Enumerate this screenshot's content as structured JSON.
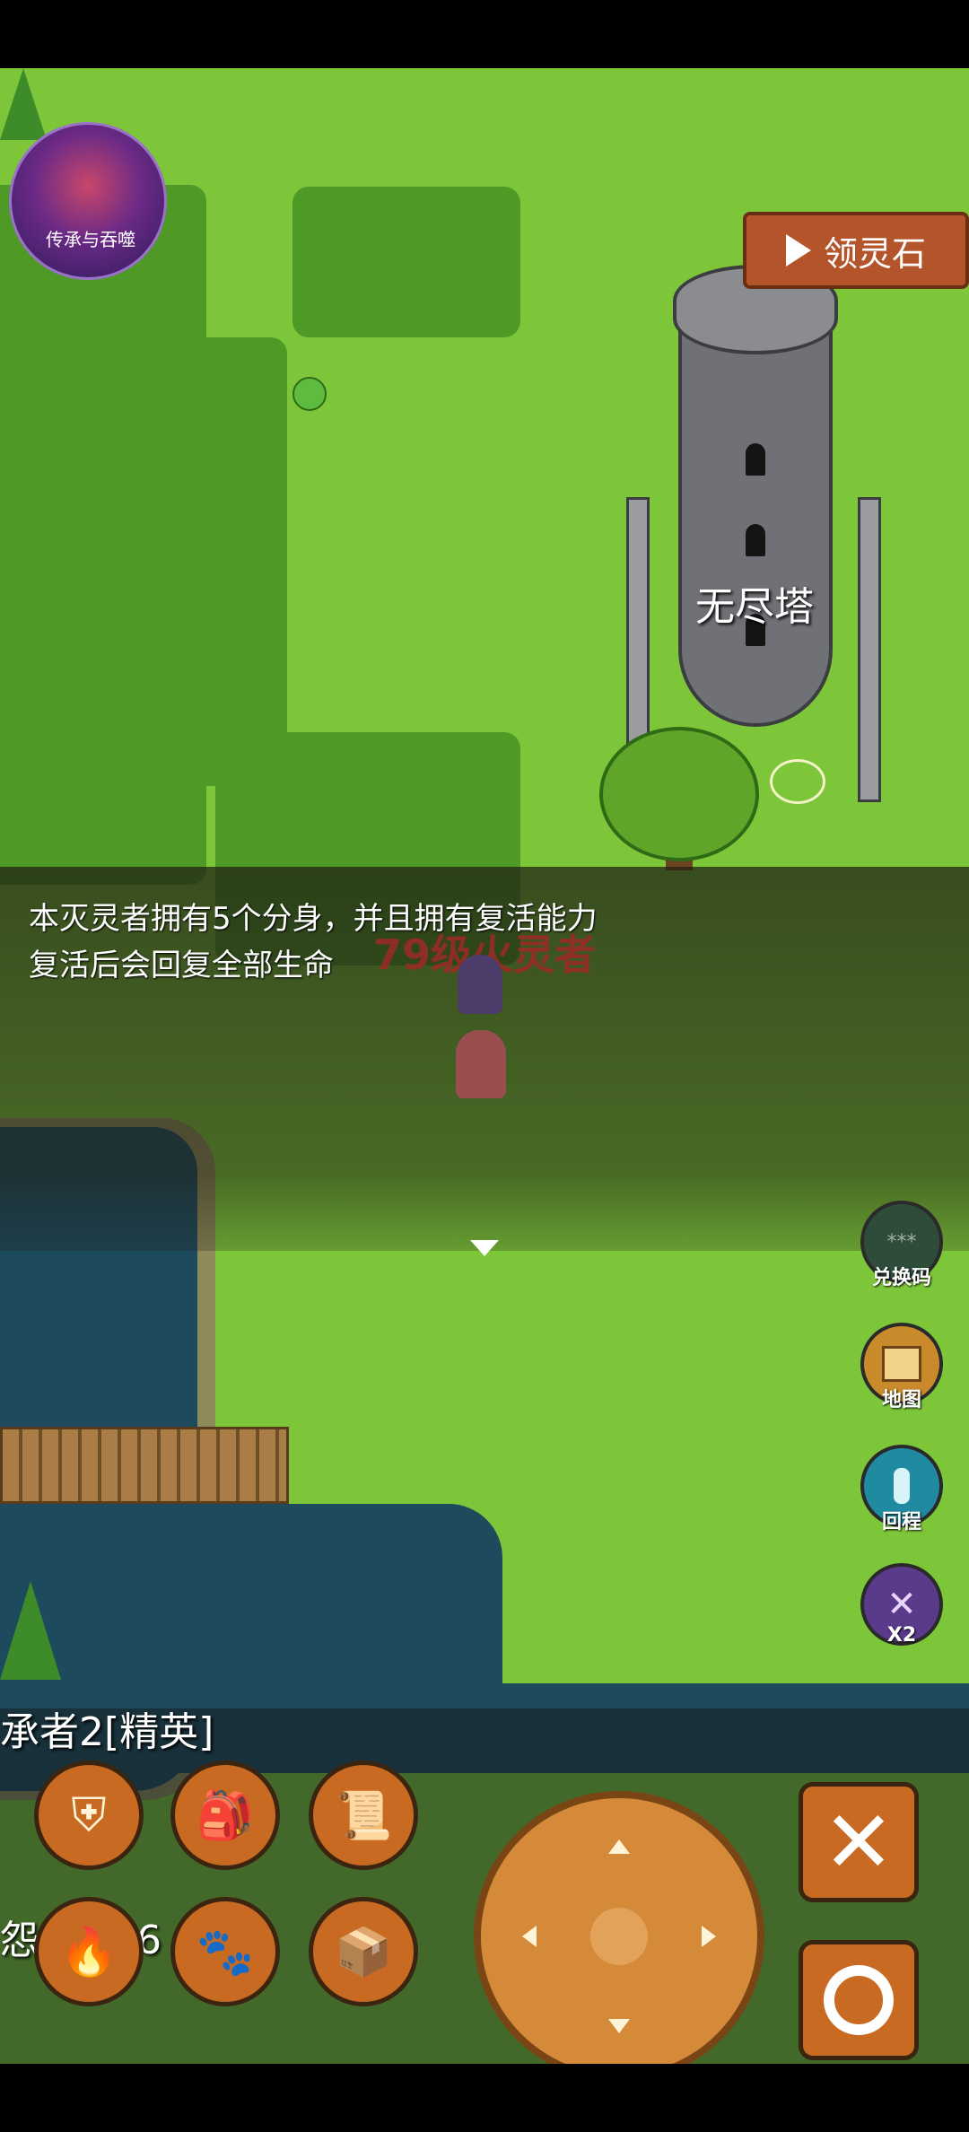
{
  "sign_button": {
    "label": "领灵石",
    "icon": "play-icon"
  },
  "tower": {
    "name": "无尽塔"
  },
  "dialog": {
    "line1": "本灭灵者拥有5个分身，并且拥有复活能力",
    "line2": "复活后会回复全部生命",
    "npc_label": "79级火灵者"
  },
  "avatar": {
    "label": "传承与吞噬"
  },
  "side_buttons": [
    {
      "label": "兑换码",
      "icon": "code-icon",
      "color": "#2f4c3a"
    },
    {
      "label": "地图",
      "icon": "map-icon",
      "color": "#c88a2a"
    },
    {
      "label": "回程",
      "icon": "return-icon",
      "color": "#1f8aa0"
    },
    {
      "label": "X2",
      "icon": "crossed-swords-icon",
      "color": "#5a3a8a"
    }
  ],
  "hud": {
    "name": "承者2[精英]",
    "partial_text": "怨",
    "partial_num": "16"
  },
  "skills": [
    {
      "icon": "armor-icon",
      "glyph": "⛨"
    },
    {
      "icon": "backpack-icon",
      "glyph": "🎒"
    },
    {
      "icon": "scroll-icon",
      "glyph": "📜"
    },
    {
      "icon": "fire-hand-icon",
      "glyph": "🔥"
    },
    {
      "icon": "paw-icon",
      "glyph": "🐾"
    },
    {
      "icon": "box-icon",
      "glyph": "📦"
    }
  ],
  "actions": {
    "cancel_glyph": "✕",
    "confirm_glyph": "○"
  }
}
